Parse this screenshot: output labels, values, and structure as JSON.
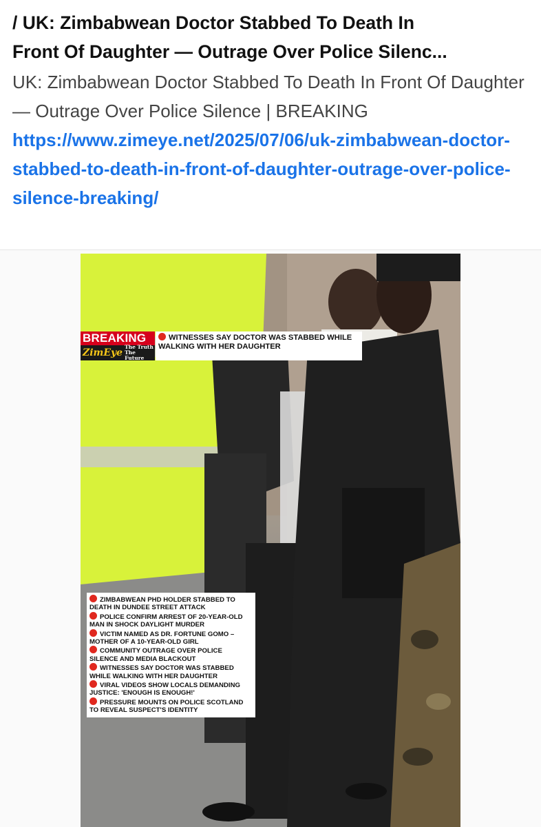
{
  "post": {
    "title_line1": "/  UK: Zimbabwean Doctor Stabbed To Death In",
    "title_line2": "Front Of Daughter — Outrage Over Police Silenc...",
    "body_text": "UK: Zimbabwean Doctor Stabbed To Death In Front Of Daughter — Outrage Over Police Silence | BREAKING ",
    "link_text": "https://www.zimeye.net/2025/07/06/uk-zimbabwean-doctor-stabbed-to-death-in-front-of-daughter-outrage-over-police-silence-breaking/"
  },
  "image": {
    "breaking_label": "BREAKING",
    "logo_text": "ZimEye",
    "logo_tagline_1": "The Truth",
    "logo_tagline_2": "The Future",
    "headline": "WITNESSES SAY DOCTOR WAS STABBED WHILE WALKING WITH HER DAUGHTER",
    "bullets": [
      "ZIMBABWEAN PhD HOLDER STABBED TO DEATH IN DUNDEE STREET ATTACK",
      "POLICE CONFIRM ARREST OF 20-YEAR-OLD MAN IN SHOCK DAYLIGHT MURDER",
      "VICTIM NAMED AS DR. FORTUNE GOMO – MOTHER OF A 10-YEAR-OLD GIRL",
      "COMMUNITY OUTRAGE OVER POLICE SILENCE AND MEDIA BLACKOUT",
      "WITNESSES SAY DOCTOR WAS STABBED WHILE WALKING WITH HER DAUGHTER",
      "VIRAL VIDEOS SHOW LOCALS DEMANDING JUSTICE: 'ENOUGH IS ENOUGH!'",
      "PRESSURE MOUNTS ON POLICE SCOTLAND TO REVEAL SUSPECT'S IDENTITY"
    ]
  },
  "colors": {
    "link": "#1a73e8",
    "breaking_red": "#d6001c",
    "bullet_dot": "#e0281f",
    "hi_vis": "#d8f23a"
  }
}
